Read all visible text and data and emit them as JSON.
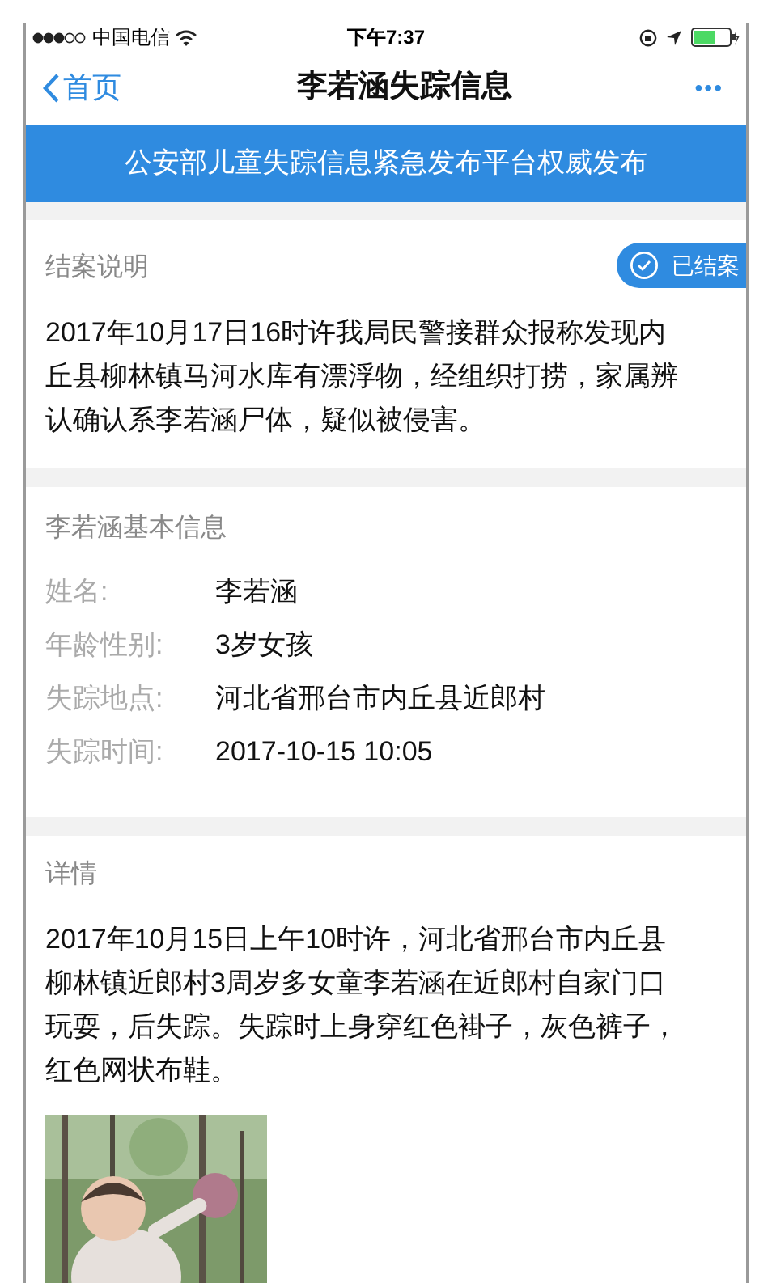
{
  "status_bar": {
    "carrier": "中国电信",
    "time": "下午7:37"
  },
  "nav": {
    "back": "首页",
    "title": "李若涵失踪信息",
    "more": "•••"
  },
  "banner": "公安部儿童失踪信息紧急发布平台权威发布",
  "closure": {
    "heading": "结案说明",
    "badge": "已结案",
    "text": "2017年10月17日16时许我局民警接群众报称发现内丘县柳林镇马河水库有漂浮物，经组织打捞，家属辨认确认系李若涵尸体，疑似被侵害。"
  },
  "basic_info": {
    "heading": "李若涵基本信息",
    "rows": [
      {
        "label": "姓名:",
        "value": "李若涵"
      },
      {
        "label": "年龄性别:",
        "value": "3岁女孩"
      },
      {
        "label": "失踪地点:",
        "value": "河北省邢台市内丘县近郎村"
      },
      {
        "label": "失踪时间:",
        "value": "2017-10-15 10:05"
      }
    ]
  },
  "details": {
    "heading": "详情",
    "text": "2017年10月15日上午10时许，河北省邢台市内丘县柳林镇近郎村3周岁多女童李若涵在近郎村自家门口玩耍，后失踪。失踪时上身穿红色褂子，灰色裤子，红色网状布鞋。"
  }
}
